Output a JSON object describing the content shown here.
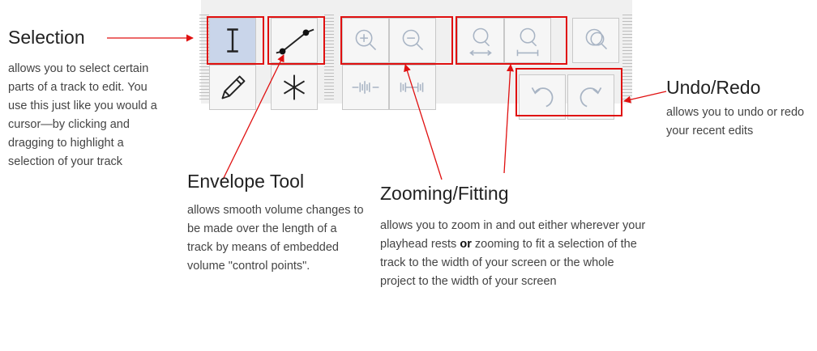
{
  "toolbar": {
    "row1": [
      {
        "icon": "i-beam-icon",
        "active": true
      },
      {
        "icon": "envelope-icon"
      },
      {
        "icon": "zoom-in-icon"
      },
      {
        "icon": "zoom-out-icon"
      },
      {
        "icon": "fit-selection-icon"
      },
      {
        "icon": "fit-project-icon"
      },
      {
        "icon": "zoom-toggle-icon"
      }
    ],
    "row2": [
      {
        "icon": "pencil-icon"
      },
      {
        "icon": "multi-tool-icon"
      },
      {
        "icon": "trim-outside-icon"
      },
      {
        "icon": "silence-selection-icon"
      },
      {
        "icon": "undo-icon"
      },
      {
        "icon": "redo-icon"
      }
    ]
  },
  "annotations": {
    "selection": {
      "title": "Selection",
      "desc": "allows you to select certain parts of a track to edit. You use this just like you would a cursor—by clicking and dragging to highlight a selection of your track"
    },
    "envelope": {
      "title": "Envelope Tool",
      "desc": "allows smooth volume changes to be made over the length of a track by means of embedded volume \"control points\"."
    },
    "zoom": {
      "title": "Zooming/Fitting",
      "desc_1": "allows you to zoom in and out either wherever your playhead rests",
      "desc_or": "or",
      "desc_2": "zooming to fit a selection of the track to the width of your screen or the whole project to the width of your screen"
    },
    "undo": {
      "title": "Undo/Redo",
      "desc": "allows you to undo or redo your recent edits"
    }
  },
  "colors": {
    "highlight": "#e01010",
    "active_button": "#c9d5ea",
    "toolbar_bg": "#f0f0f0",
    "icon_faded": "#a8b4c4"
  }
}
